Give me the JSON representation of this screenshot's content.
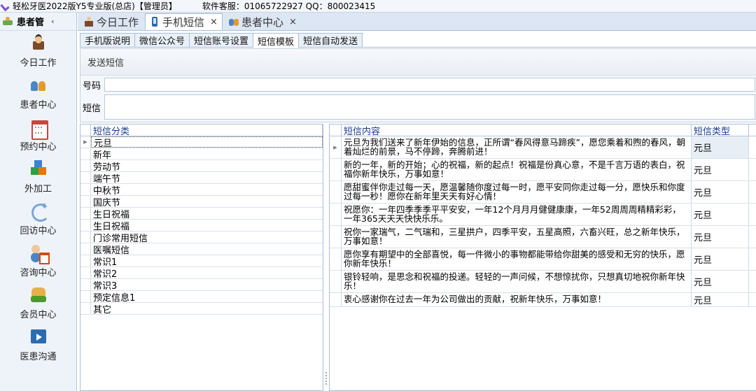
{
  "window": {
    "title": "轻松牙医2022版Y5专业版(总店)【管理员】",
    "support": "软件客服：01065722927 QQ：800023415"
  },
  "sidebar": {
    "header": "患者管",
    "collapse": "‹",
    "items": [
      {
        "label": "今日工作",
        "icon": "manager-icon"
      },
      {
        "label": "患者中心",
        "icon": "patients-icon"
      },
      {
        "label": "预约中心",
        "icon": "calendar-icon"
      },
      {
        "label": "外加工",
        "icon": "blocks-icon"
      },
      {
        "label": "回访中心",
        "icon": "refresh-icon"
      },
      {
        "label": "咨询中心",
        "icon": "consultant-icon"
      },
      {
        "label": "会员中心",
        "icon": "member-icon"
      },
      {
        "label": "医患沟通",
        "icon": "video-icon"
      }
    ]
  },
  "doc_tabs": [
    {
      "label": "今日工作",
      "active": false
    },
    {
      "label": "手机短信",
      "active": true,
      "close": "×"
    },
    {
      "label": "患者中心",
      "active": false,
      "close": "×"
    }
  ],
  "sub_tabs": [
    "手机版说明",
    "微信公众号",
    "短信账号设置",
    "短信模板",
    "短信自动发送"
  ],
  "send_panel": {
    "title": "发送短信",
    "phone_label": "号码",
    "phone_value": "",
    "sms_label": "短信",
    "sms_value": ""
  },
  "category_grid": {
    "header": "短信分类",
    "rows": [
      "元旦",
      "新年",
      "劳动节",
      "端午节",
      "中秋节",
      "国庆节",
      "生日祝福",
      "生日祝福",
      "门诊常用短信",
      "医嘱短信",
      "常识1",
      "常识2",
      "常识3",
      "预定信息1",
      "其它"
    ]
  },
  "message_grid": {
    "headers": {
      "content": "短信内容",
      "type": "短信类型"
    },
    "rows": [
      {
        "content": "元旦为我们送来了新年伊始的信息，正所谓“春风得意马蹄疾”，愿您乘着和煦的春风，朝着灿烂的前景，马不停蹄，奔腾前进！",
        "type": "元旦"
      },
      {
        "content": "新的一年，新的开始；心的祝福，新的起点！祝福是份真心意，不是千言万语的表白，祝福你新年快乐，万事如意！",
        "type": "元旦"
      },
      {
        "content": "愿甜蜜伴你走过每一天，愿温馨随你度过每一时，愿平安同你走过每一分，愿快乐和你度过每一秒！愿你在新年里天天有好心情！",
        "type": "元旦"
      },
      {
        "content": "祝愿你：一年四季季季平平安安，一年12个月月月健健康康，一年52周周周精精彩彩，一年365天天天快快乐乐。",
        "type": "元旦"
      },
      {
        "content": "祝你一家瑞气，二气瑞和，三星拱户，四季平安，五星高照，六畜兴旺，总之新年快乐，万事如意！",
        "type": "元旦"
      },
      {
        "content": "愿你享有期望中的全部喜悦，每一件微小的事物都能带给你甜美的感受和无穷的快乐，愿你新年快乐！",
        "type": "元旦"
      },
      {
        "content": "银铃轻响，是思念和祝福的投递。轻轻的一声问候，不想惊扰你，只想真切地祝你新年快乐！",
        "type": "元旦"
      },
      {
        "content": "衷心感谢你在过去一年为公司做出的贡献，祝新年快乐，万事如意！",
        "type": "元旦"
      }
    ]
  },
  "colors": {
    "header_text": "#1b3c8c",
    "tab_bar": "#dde7f4",
    "sidebar_bg": "#eef3fa"
  }
}
